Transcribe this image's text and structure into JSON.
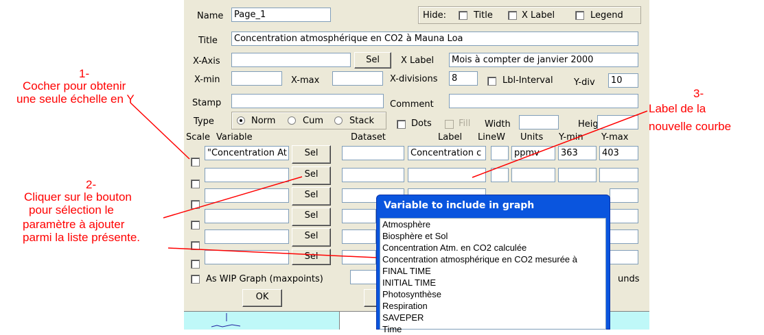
{
  "form": {
    "name_label": "Name",
    "name_value": "Page_1",
    "hide_label": "Hide:",
    "hide_title": "Title",
    "hide_xlabel": "X Label",
    "hide_legend": "Legend",
    "title_label": "Title",
    "title_value": "Concentration atmosphérique en CO2 à Mauna Loa",
    "xaxis_label": "X-Axis",
    "xaxis_value": "",
    "sel_label": "Sel",
    "xlabel_label": "X Label",
    "xlabel_value": "Mois à compter de janvier 2000",
    "xmin_label": "X-min",
    "xmax_label": "X-max",
    "xdiv_label": "X-divisions",
    "xdiv_value": "8",
    "lblint_label": "Lbl-Interval",
    "ydiv_label": "Y-div",
    "ydiv_value": "10",
    "stamp_label": "Stamp",
    "comment_label": "Comment",
    "type_label": "Type",
    "type_norm": "Norm",
    "type_cum": "Cum",
    "type_stack": "Stack",
    "dots_label": "Dots",
    "fill_label": "Fill",
    "width_label": "Width",
    "height_label": "Height",
    "col_scale": "Scale",
    "col_variable": "Variable",
    "col_dataset": "Dataset",
    "col_label": "Label",
    "col_linew": "LineW",
    "col_units": "Units",
    "col_ymin": "Y-min",
    "col_ymax": "Y-max",
    "row1_variable": "\"Concentration At",
    "row1_label": "Concentration c",
    "row1_units": "ppmv",
    "row1_ymin": "363",
    "row1_ymax": "403",
    "wip_label": "As WIP Graph (maxpoints)",
    "unds_text": "unds",
    "ok_label": "OK"
  },
  "popup": {
    "title": "Variable to include in graph",
    "items": [
      "Atmosphère",
      "Biosphère et Sol",
      "Concentration Atm. en CO2 calculée",
      "Concentration atmosphérique en CO2 mesurée à",
      "FINAL TIME",
      "INITIAL TIME",
      "Photosynthèse",
      "Respiration",
      "SAVEPER",
      "Time"
    ]
  },
  "annotations": {
    "a1_num": "1-",
    "a1_line1": "Cocher pour obtenir",
    "a1_line2": "une seule échelle en Y",
    "a2_num": "2-",
    "a2_line1": "Cliquer sur le bouton",
    "a2_line2": "pour sélection le",
    "a2_line3": "paramètre à ajouter",
    "a2_line4": "parmi la liste présente.",
    "a3_num": "3-",
    "a3_line1": "Label de la",
    "a3_line2": "nouvelle courbe"
  },
  "colors": {
    "annotation": "#ff0000",
    "dialog": "#ece9d8",
    "popup_title_bar": "#0a55de",
    "plot_area": "#bff8f8"
  }
}
